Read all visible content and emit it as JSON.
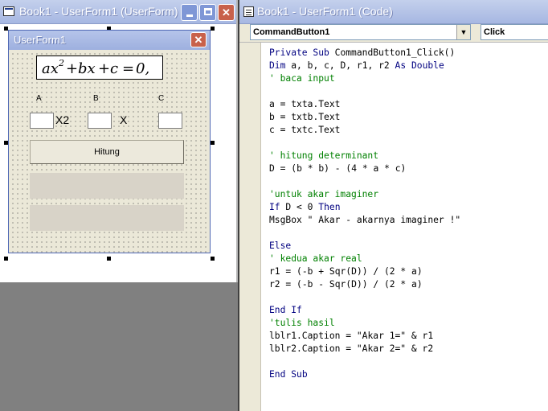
{
  "designer_window": {
    "title": "Book1 - UserForm1 (UserForm)",
    "minimize_glyph": "minimize-icon",
    "maximize_glyph": "maximize-icon",
    "close_glyph": "✕"
  },
  "userform": {
    "title": "UserForm1",
    "close_glyph": "✕",
    "equation_image": "ax² + bx + c = 0,",
    "label_a": "A",
    "label_b": "B",
    "label_c": "C",
    "suffix_x2": "X2",
    "suffix_x": "X",
    "button_label": "Hitung",
    "txta_value": "",
    "txtb_value": "",
    "txtc_value": "",
    "lblr1_caption": "",
    "lblr2_caption": ""
  },
  "code_window": {
    "title": "Book1 - UserForm1 (Code)",
    "object_combo": "CommandButton1",
    "procedure_combo": "Click",
    "combo_arrow": "▼",
    "lines": [
      {
        "text": "Private Sub CommandButton1_Click()",
        "type": "code"
      },
      {
        "text": "Dim a, b, c, D, r1, r2 As Double",
        "type": "code"
      },
      {
        "text": "' baca input",
        "type": "comment"
      },
      {
        "text": "",
        "type": "code"
      },
      {
        "text": "a = txta.Text",
        "type": "code"
      },
      {
        "text": "b = txtb.Text",
        "type": "code"
      },
      {
        "text": "c = txtc.Text",
        "type": "code"
      },
      {
        "text": "",
        "type": "code"
      },
      {
        "text": "' hitung determinant",
        "type": "comment"
      },
      {
        "text": "D = (b * b) - (4 * a * c)",
        "type": "code"
      },
      {
        "text": "",
        "type": "code"
      },
      {
        "text": "'untuk akar imaginer",
        "type": "comment"
      },
      {
        "text": "If D < 0 Then",
        "type": "code"
      },
      {
        "text": "MsgBox \" Akar - akarnya imaginer !\"",
        "type": "code"
      },
      {
        "text": "",
        "type": "code"
      },
      {
        "text": "Else",
        "type": "code"
      },
      {
        "text": "' kedua akar real",
        "type": "comment"
      },
      {
        "text": "r1 = (-b + Sqr(D)) / (2 * a)",
        "type": "code"
      },
      {
        "text": "r2 = (-b - Sqr(D)) / (2 * a)",
        "type": "code"
      },
      {
        "text": "",
        "type": "code"
      },
      {
        "text": "End If",
        "type": "code"
      },
      {
        "text": "'tulis hasil",
        "type": "comment"
      },
      {
        "text": "lblr1.Caption = \"Akar 1=\" & r1",
        "type": "code"
      },
      {
        "text": "lblr2.Caption = \"Akar 2=\" & r2",
        "type": "code"
      },
      {
        "text": "",
        "type": "code"
      },
      {
        "text": "End Sub",
        "type": "code"
      }
    ]
  },
  "colors": {
    "comment": "#008000",
    "keyword": "#000080",
    "title_gradient_top": "#c4d0ec",
    "title_gradient_bottom": "#a6b7e2",
    "form_background": "#ebe8d8",
    "empty_area": "#808080"
  }
}
